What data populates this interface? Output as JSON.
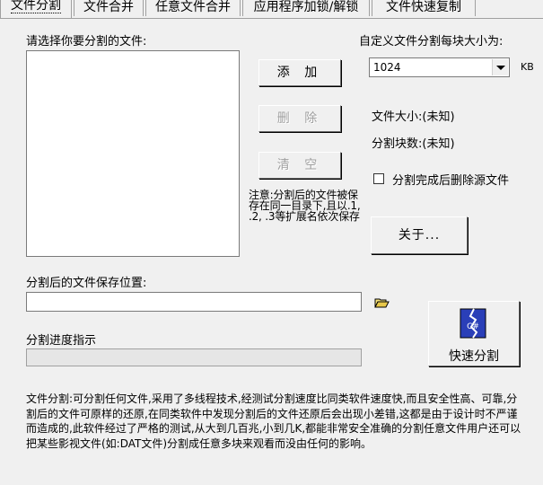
{
  "tabs": [
    {
      "label": "文件分割",
      "active": true
    },
    {
      "label": "文件合并",
      "active": false
    },
    {
      "label": "任意文件合并",
      "active": false
    },
    {
      "label": "应用程序加锁/解锁",
      "active": false
    },
    {
      "label": "文件快速复制",
      "active": false
    }
  ],
  "labels": {
    "select_files": "请选择你要分割的文件:",
    "chunk_size": "自定义文件分割每块大小为:",
    "chunk_unit": "KB",
    "file_size": "文件大小:(未知)",
    "chunk_count": "分割块数:(未知)",
    "delete_source": "分割完成后删除源文件",
    "note": "注意:分割后的文件被保存在同一目录下,且以.1, .2, .3等扩展名依次保存",
    "save_location": "分割后的文件保存位置:",
    "progress": "分割进度指示"
  },
  "buttons": {
    "add": "添 加",
    "delete": "删 除",
    "clear": "清 空",
    "about": "关于...",
    "quick_split": "快速分割"
  },
  "fields": {
    "chunk_size_value": "1024",
    "save_path": ""
  },
  "state": {
    "delete_source_checked": false,
    "delete_enabled": false,
    "clear_enabled": false,
    "progress": 0
  },
  "description": "文件分割:可分割任何文件,采用了多线程技术,经测试分割速度比同类软件速度快,而且安全性高、可靠,分割后的文件可原样的还原,在同类软件中发现分割后的文件还原后会出现小差错,这都是由于设计时不严谨而造成的,此软件经过了严格的测试,从大到几百兆,小到几K,都能非常安全准确的分割任意文件用户还可以把某些影视文件(如:DAT文件)分割成任意多块来观看而没由任何的影响。",
  "icons": {
    "folder": "folder-open-icon",
    "split": "split-file-icon"
  }
}
